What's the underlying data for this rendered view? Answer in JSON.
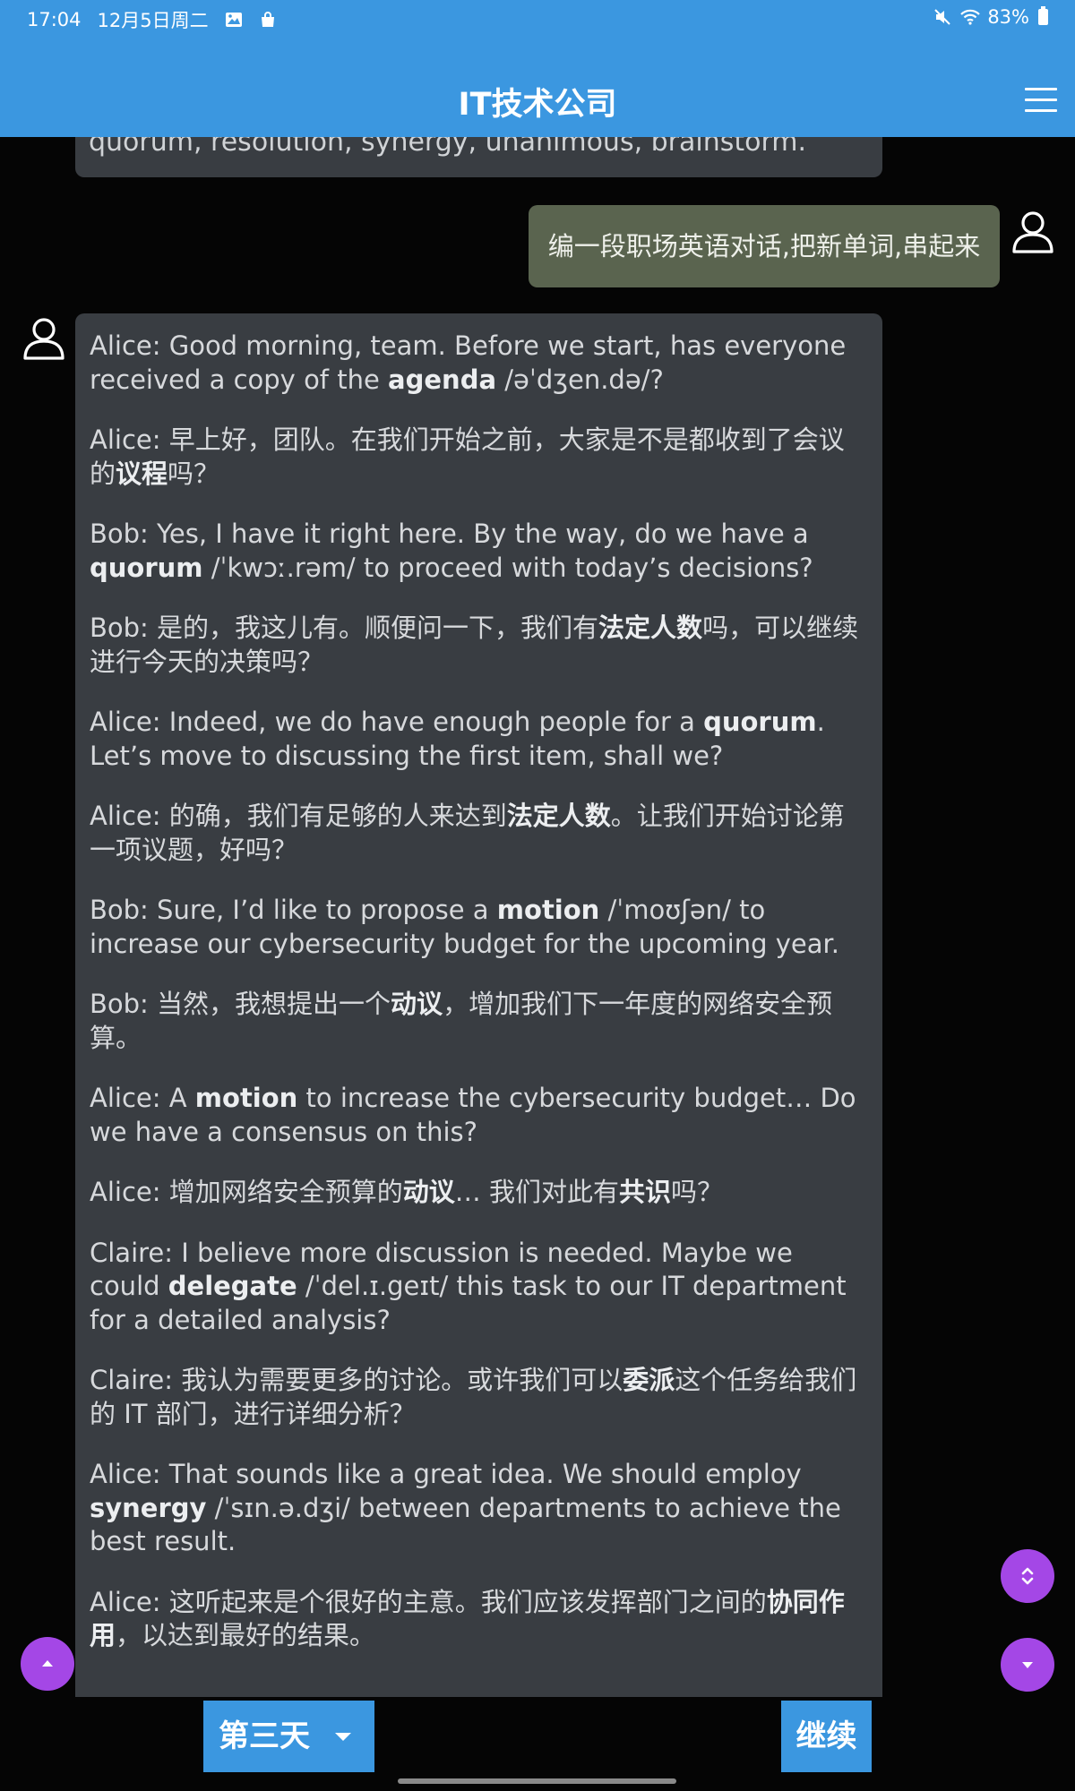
{
  "status_bar": {
    "time": "17:04",
    "date": "12月5日周二",
    "battery": "83%",
    "icons": [
      "image-icon",
      "shopping-bag-icon",
      "mute-icon",
      "wifi-icon",
      "battery-icon"
    ]
  },
  "header": {
    "title": "IT技术公司",
    "menu_icon": "hamburger-menu-icon"
  },
  "chat": {
    "previous_text": "quorum, resolution, synergy, unanimous, brainstorm.",
    "user_message": "编一段职场英语对话,把新单词,串起来",
    "reply": [
      [
        {
          "t": "Alice: Good morning, team. Before we start, has everyone received a copy of the "
        },
        {
          "t": "agenda",
          "b": true
        },
        {
          "t": " /əˈdʒen.də/?"
        }
      ],
      [
        {
          "t": "Alice: 早上好，团队。在我们开始之前，大家是不是都收到了会议的"
        },
        {
          "t": "议程",
          "b": true
        },
        {
          "t": "吗？"
        }
      ],
      [
        {
          "t": "Bob: Yes, I have it right here. By the way, do we have a "
        },
        {
          "t": "quorum",
          "b": true
        },
        {
          "t": " /ˈkwɔː.rəm/ to proceed with today’s decisions?"
        }
      ],
      [
        {
          "t": "Bob: 是的，我这儿有。顺便问一下，我们有"
        },
        {
          "t": "法定人数",
          "b": true
        },
        {
          "t": "吗，可以继续进行今天的决策吗？"
        }
      ],
      [
        {
          "t": "Alice: Indeed, we do have enough people for a "
        },
        {
          "t": "quorum",
          "b": true
        },
        {
          "t": ". Let’s move to discussing the first item, shall we?"
        }
      ],
      [
        {
          "t": "Alice: 的确，我们有足够的人来达到"
        },
        {
          "t": "法定人数",
          "b": true
        },
        {
          "t": "。让我们开始讨论第一项议题，好吗？"
        }
      ],
      [
        {
          "t": "Bob: Sure, I’d like to propose a "
        },
        {
          "t": "motion",
          "b": true
        },
        {
          "t": " /ˈmoʊʃən/ to increase our cybersecurity budget for the upcoming year."
        }
      ],
      [
        {
          "t": "Bob: 当然，我想提出一个"
        },
        {
          "t": "动议",
          "b": true
        },
        {
          "t": "，增加我们下一年度的网络安全预算。"
        }
      ],
      [
        {
          "t": "Alice: A "
        },
        {
          "t": "motion",
          "b": true
        },
        {
          "t": " to increase the cybersecurity budget… Do we have a consensus on this?"
        }
      ],
      [
        {
          "t": "Alice: 增加网络安全预算的"
        },
        {
          "t": "动议",
          "b": true
        },
        {
          "t": "… 我们对此有"
        },
        {
          "t": "共识",
          "b": true
        },
        {
          "t": "吗？"
        }
      ],
      [
        {
          "t": "Claire: I believe more discussion is needed. Maybe we could "
        },
        {
          "t": "delegate",
          "b": true
        },
        {
          "t": " /ˈdel.ɪ.geɪt/ this task to our IT department for a detailed analysis?"
        }
      ],
      [
        {
          "t": "Claire: 我认为需要更多的讨论。或许我们可以"
        },
        {
          "t": "委派",
          "b": true
        },
        {
          "t": "这个任务给我们的 IT 部门，进行详细分析？"
        }
      ],
      [
        {
          "t": "Alice: That sounds like a great idea. We should employ "
        },
        {
          "t": "synergy",
          "b": true
        },
        {
          "t": " /ˈsɪn.ə.dʒi/ between departments to achieve the best result."
        }
      ],
      [
        {
          "t": "Alice: 这听起来是个很好的主意。我们应该发挥部门之间的"
        },
        {
          "t": "协同作用",
          "b": true
        },
        {
          "t": "，以达到最好的结果。"
        }
      ]
    ]
  },
  "fabs": {
    "top_icon": "scroll-to-top-icon",
    "expand_icon": "expand-collapse-icon",
    "down_icon": "scroll-down-icon",
    "color": "#a447e6"
  },
  "bottom_bar": {
    "day_label": "第三天",
    "continue_label": "继续"
  },
  "colors": {
    "header": "#3b97e0",
    "background": "#050505",
    "bot_bubble": "#393d42",
    "user_bubble": "#5a644f"
  }
}
